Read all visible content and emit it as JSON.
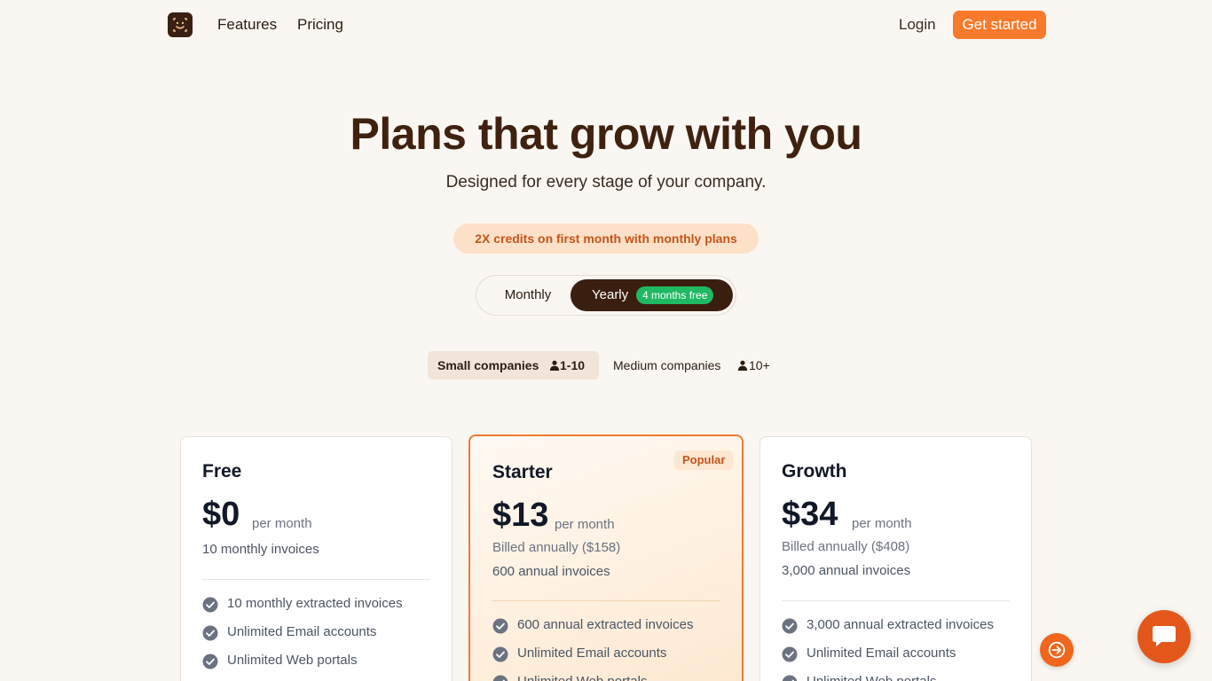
{
  "nav": {
    "links": [
      "Features",
      "Pricing"
    ],
    "login": "Login",
    "cta": "Get started"
  },
  "hero": {
    "title": "Plans that grow with you",
    "subtitle": "Designed for every stage of your company."
  },
  "promo": "2X credits on first month with monthly plans",
  "billing": {
    "monthly": "Monthly",
    "yearly": "Yearly",
    "yearly_badge": "4 months free",
    "selected": "Yearly"
  },
  "company_size": {
    "selected": "Small companies",
    "options": [
      {
        "label": "Small companies",
        "count": "1-10"
      },
      {
        "label": "Medium companies",
        "count": "10+"
      }
    ]
  },
  "plans": [
    {
      "name": "Free",
      "price": "$0",
      "period": "per month",
      "billed": "",
      "invoices": "10 monthly invoices",
      "features": [
        "10 monthly extracted invoices",
        "Unlimited Email accounts",
        "Unlimited Web portals"
      ]
    },
    {
      "name": "Starter",
      "badge": "Popular",
      "price": "$13",
      "period": "per month",
      "billed": "Billed annually ($158)",
      "invoices": "600 annual invoices",
      "features": [
        "600 annual extracted invoices",
        "Unlimited Email accounts",
        "Unlimited Web portals"
      ]
    },
    {
      "name": "Growth",
      "price": "$34",
      "period": "per month",
      "billed": "Billed annually ($408)",
      "invoices": "3,000 annual invoices",
      "features": [
        "3,000 annual extracted invoices",
        "Unlimited Email accounts",
        "Unlimited Web portals"
      ]
    }
  ],
  "icons": {
    "logo": "smiley-logo-icon",
    "check": "check-circle-icon",
    "person": "person-icon",
    "next": "arrow-right-icon",
    "chat": "chat-bubble-icon"
  },
  "colors": {
    "accent": "#f97a2a",
    "dark_brown": "#3a1e10",
    "green_badge": "#1fb863",
    "background": "#faf7f2"
  }
}
